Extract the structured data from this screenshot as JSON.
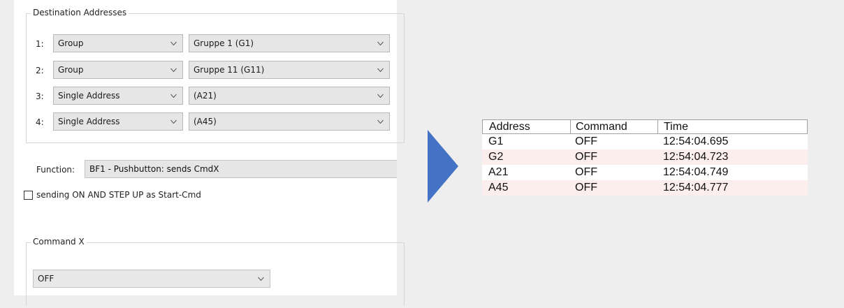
{
  "destination": {
    "legend": "Destination Addresses",
    "rows": [
      {
        "num": "1:",
        "type": "Group",
        "target": "Gruppe 1 (G1)"
      },
      {
        "num": "2:",
        "type": "Group",
        "target": "Gruppe 11 (G11)"
      },
      {
        "num": "3:",
        "type": "Single Address",
        "target": "(A21)"
      },
      {
        "num": "4:",
        "type": "Single Address",
        "target": "(A45)"
      }
    ]
  },
  "function": {
    "label": "Function:",
    "value": "BF1 - Pushbutton:  sends CmdX"
  },
  "checkbox": {
    "label": "sending ON AND STEP UP as Start-Cmd",
    "checked": false
  },
  "command": {
    "legend": "Command X",
    "value": "OFF"
  },
  "arrow": {
    "icon": "right-arrow-icon",
    "color": "#4472c4"
  },
  "results": {
    "headers": [
      "Address",
      "Command",
      "Time"
    ],
    "rows": [
      {
        "address": "G1",
        "command": "OFF",
        "time": "12:54:04.695"
      },
      {
        "address": "G2",
        "command": "OFF",
        "time": "12:54:04.723"
      },
      {
        "address": "A21",
        "command": "OFF",
        "time": "12:54:04.749"
      },
      {
        "address": "A45",
        "command": "OFF",
        "time": "12:54:04.777"
      }
    ]
  }
}
